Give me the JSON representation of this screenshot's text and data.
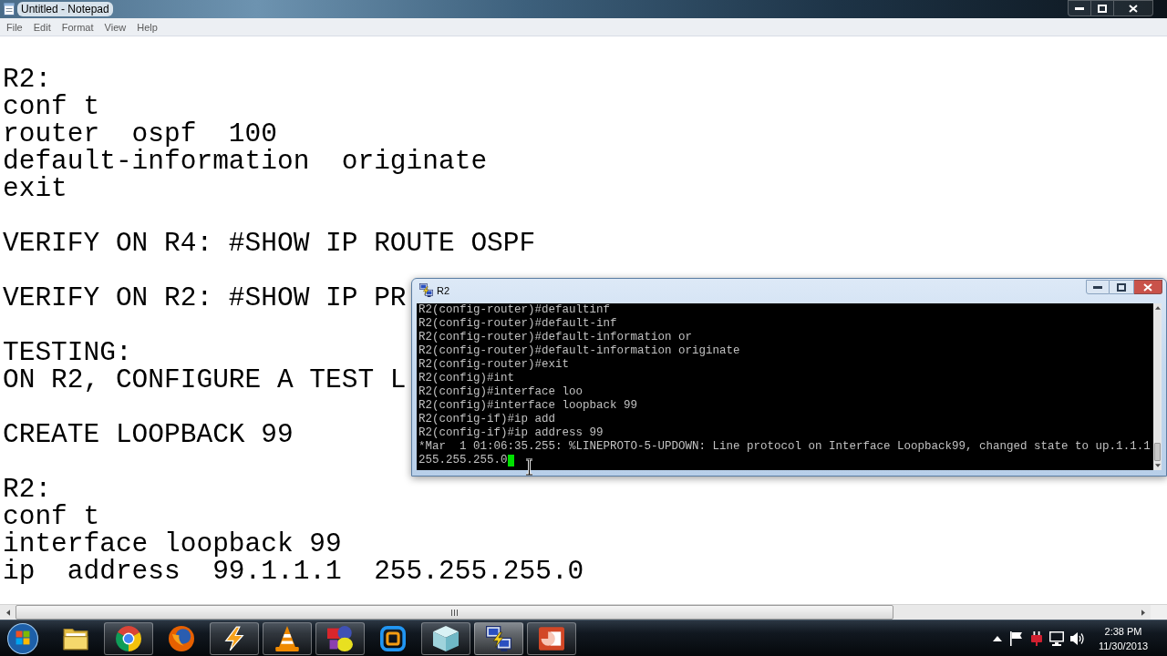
{
  "notepad": {
    "title": "Untitled - Notepad",
    "menu": [
      "File",
      "Edit",
      "Format",
      "View",
      "Help"
    ],
    "blocks": [
      [
        "R2:",
        "conf t",
        "router  ospf  100",
        "default-information  originate",
        "exit"
      ],
      [
        "VERIFY ON R4: #SHOW IP ROUTE OSPF"
      ],
      [
        "VERIFY ON R2: #SHOW IP PR"
      ],
      [
        "TESTING:",
        "ON R2, CONFIGURE A TEST L"
      ],
      [
        "CREATE LOOPBACK 99"
      ],
      [
        "R2:",
        "conf t",
        "interface loopback 99",
        "ip  address  99.1.1.1  255.255.255.0"
      ]
    ]
  },
  "terminal": {
    "title": "R2",
    "lines": [
      "R2(config-router)#defaultinf",
      "R2(config-router)#default-inf",
      "R2(config-router)#default-information or",
      "R2(config-router)#default-information originate",
      "R2(config-router)#exit",
      "R2(config)#int",
      "R2(config)#interface loo",
      "R2(config)#interface loopback 99",
      "R2(config-if)#ip add",
      "R2(config-if)#ip address 99",
      "*Mar  1 01:06:35.255: %LINEPROTO-5-UPDOWN: Line protocol on Interface Loopback99, changed state to up.1.1.1"
    ],
    "input": "255.255.255.0"
  },
  "taskbar": {
    "buttons": [
      {
        "running": false,
        "selected": false
      },
      {
        "running": true,
        "selected": false
      },
      {
        "running": false,
        "selected": false
      },
      {
        "running": true,
        "selected": false
      },
      {
        "running": true,
        "selected": false
      },
      {
        "running": true,
        "selected": false
      },
      {
        "running": false,
        "selected": false
      },
      {
        "running": true,
        "selected": false
      },
      {
        "running": true,
        "selected": true
      },
      {
        "running": true,
        "selected": false
      }
    ],
    "clock": {
      "time": "2:38 PM",
      "date": "11/30/2013"
    }
  }
}
